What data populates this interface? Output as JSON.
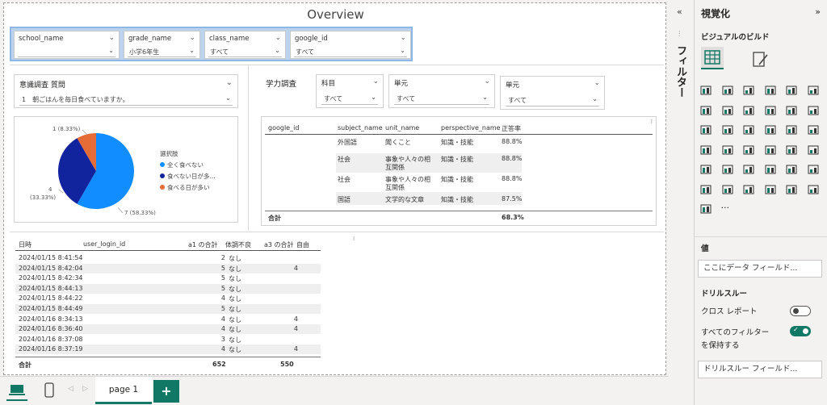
{
  "title": "Overview",
  "slicers": [
    {
      "label": "school_name",
      "value": ""
    },
    {
      "label": "grade_name",
      "value": "小学6年生"
    },
    {
      "label": "class_name",
      "value": "すべて"
    },
    {
      "label": "google_id",
      "value": "すべて"
    }
  ],
  "survey": {
    "label": "意識調査 質問",
    "value": "1　朝ごはんを毎日食べていますか。"
  },
  "pie": {
    "legend_title": "選択肢",
    "slices": [
      {
        "name": "全く食べない",
        "value": 7,
        "label": "7 (58.33%)",
        "color": "#118dff"
      },
      {
        "name": "食べない日が多...",
        "value": 4,
        "label": "4\n(33.33%)",
        "color": "#12239e"
      },
      {
        "name": "食べる日が多い",
        "value": 1,
        "label": "1 (8.33%)",
        "color": "#e66c37"
      }
    ]
  },
  "academic": {
    "label": "学力調査",
    "filters": [
      {
        "label": "科目",
        "value": "すべて"
      },
      {
        "label": "単元",
        "value": "すべて"
      },
      {
        "label": "単元",
        "value": "すべて"
      }
    ],
    "headers": [
      "google_id",
      "subject_name",
      "unit_name",
      "perspective_name",
      "正答率"
    ],
    "rows": [
      {
        "subject": "外国語",
        "unit": "聞くこと",
        "unit2": "",
        "perspective": "知識・技能",
        "rate": "88.8%"
      },
      {
        "subject": "社会",
        "unit": "事象や人々の相",
        "unit2": "互関係",
        "perspective": "知識・技能",
        "rate": "88.8%"
      },
      {
        "subject": "社会",
        "unit": "事象や人々の相",
        "unit2": "互関係",
        "perspective": "知識・技能",
        "rate": "88.8%"
      },
      {
        "subject": "国語",
        "unit": "文学的な文章",
        "unit2": "",
        "perspective": "知識・技能",
        "rate": "87.5%"
      }
    ],
    "total_label": "合計",
    "total_value": "68.3%"
  },
  "log": {
    "headers": [
      "日時",
      "user_login_id",
      "a1 の合計",
      "体調不良",
      "a3 の合計",
      "自由"
    ],
    "rows": [
      {
        "date": "2024/01/15 8:41:54",
        "a1": "2",
        "cond": "なし",
        "a3": ""
      },
      {
        "date": "2024/01/15 8:42:04",
        "a1": "5",
        "cond": "なし",
        "a3": "4"
      },
      {
        "date": "2024/01/15 8:42:34",
        "a1": "5",
        "cond": "なし",
        "a3": ""
      },
      {
        "date": "2024/01/15 8:44:13",
        "a1": "5",
        "cond": "なし",
        "a3": ""
      },
      {
        "date": "2024/01/15 8:44:22",
        "a1": "4",
        "cond": "なし",
        "a3": ""
      },
      {
        "date": "2024/01/15 8:44:49",
        "a1": "5",
        "cond": "なし",
        "a3": ""
      },
      {
        "date": "2024/01/16 8:34:13",
        "a1": "4",
        "cond": "なし",
        "a3": "4"
      },
      {
        "date": "2024/01/16 8:36:40",
        "a1": "4",
        "cond": "なし",
        "a3": "4"
      },
      {
        "date": "2024/01/16 8:37:08",
        "a1": "3",
        "cond": "なし",
        "a3": ""
      },
      {
        "date": "2024/01/16 8:37:19",
        "a1": "4",
        "cond": "なし",
        "a3": "4"
      }
    ],
    "total_label": "合計",
    "total_a1": "652",
    "total_a3": "550"
  },
  "viz_pane": {
    "title": "視覚化",
    "subtitle": "ビジュアルのビルド",
    "filters_label": "フィルター",
    "values_label": "値",
    "values_placeholder": "ここにデータ フィールド...",
    "drillthrough_label": "ドリルスルー",
    "cross_report_label": "クロス レポート",
    "keep_filters_label": "すべてのフィルター",
    "keep_filters_label2": "を保持する",
    "drill_placeholder": "ドリルスルー フィールド...",
    "more": "···"
  },
  "tabs": {
    "page_label": "page 1",
    "add": "+"
  },
  "colors": {
    "accent": "#118dff",
    "navy": "#12239e",
    "orange": "#e66c37",
    "green": "#117865"
  }
}
